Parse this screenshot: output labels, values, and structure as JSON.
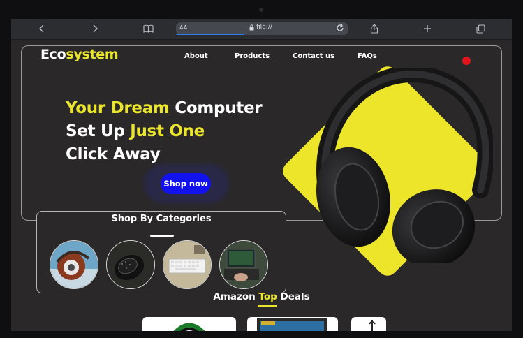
{
  "browser": {
    "address_aa": "AA",
    "url": "file://",
    "icons": [
      "back-icon",
      "forward-icon",
      "reader-icon",
      "lock-icon",
      "reload-icon",
      "share-icon",
      "new-tab-icon",
      "tabs-icon"
    ]
  },
  "logo": {
    "part1": "Eco",
    "part2": "system"
  },
  "nav": {
    "about": "About",
    "products": "Products",
    "contact": "Contact us",
    "faqs": "FAQs"
  },
  "hero": {
    "line1_y": "Your Dream",
    "line1_w": " Computer",
    "line2_w": "Set Up ",
    "line2_y": "Just One",
    "line3_w": "Click Away",
    "cta": "Shop now"
  },
  "categories": {
    "title": "Shop By Categories",
    "items": [
      "headphones-image",
      "mouse-image",
      "keyboard-image",
      "laptop-image"
    ]
  },
  "deals": {
    "t1": "Amazon ",
    "t2": "Top",
    "t3": " Deals"
  },
  "colors": {
    "accent_yellow": "#eae52c",
    "cta_blue": "#1212ef",
    "background": "#2a2829",
    "notification_red": "#e0141b"
  }
}
